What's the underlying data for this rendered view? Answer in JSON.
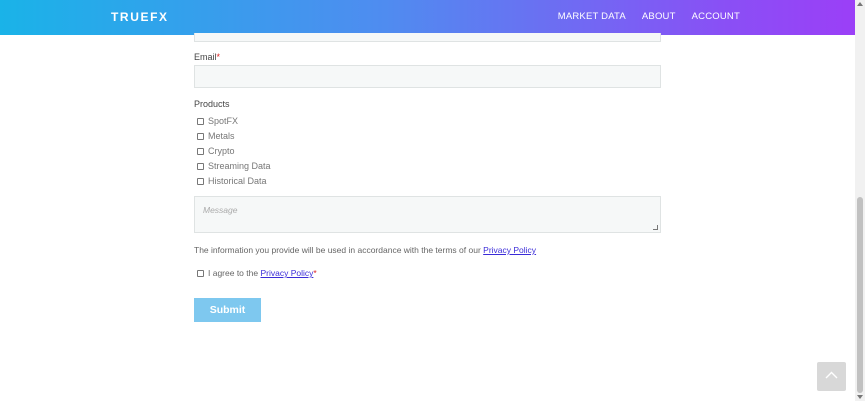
{
  "header": {
    "logo": "TRUEFX",
    "menu": [
      "MARKET DATA",
      "ABOUT",
      "ACCOUNT"
    ]
  },
  "form": {
    "email_label": "Email",
    "required_mark": "*",
    "email_value": "",
    "products_label": "Products",
    "products": [
      "SpotFX",
      "Metals",
      "Crypto",
      "Streaming Data",
      "Historical Data"
    ],
    "message_placeholder": "Message",
    "info_text": "The information you provide will be used in accordance with the terms of our ",
    "info_link": "Privacy Policy",
    "agree_text": "I agree to the ",
    "agree_link": "Privacy Policy ",
    "agree_required": "*",
    "submit_label": "Submit"
  },
  "icons": {
    "back_to_top": "chevron-up-icon"
  }
}
